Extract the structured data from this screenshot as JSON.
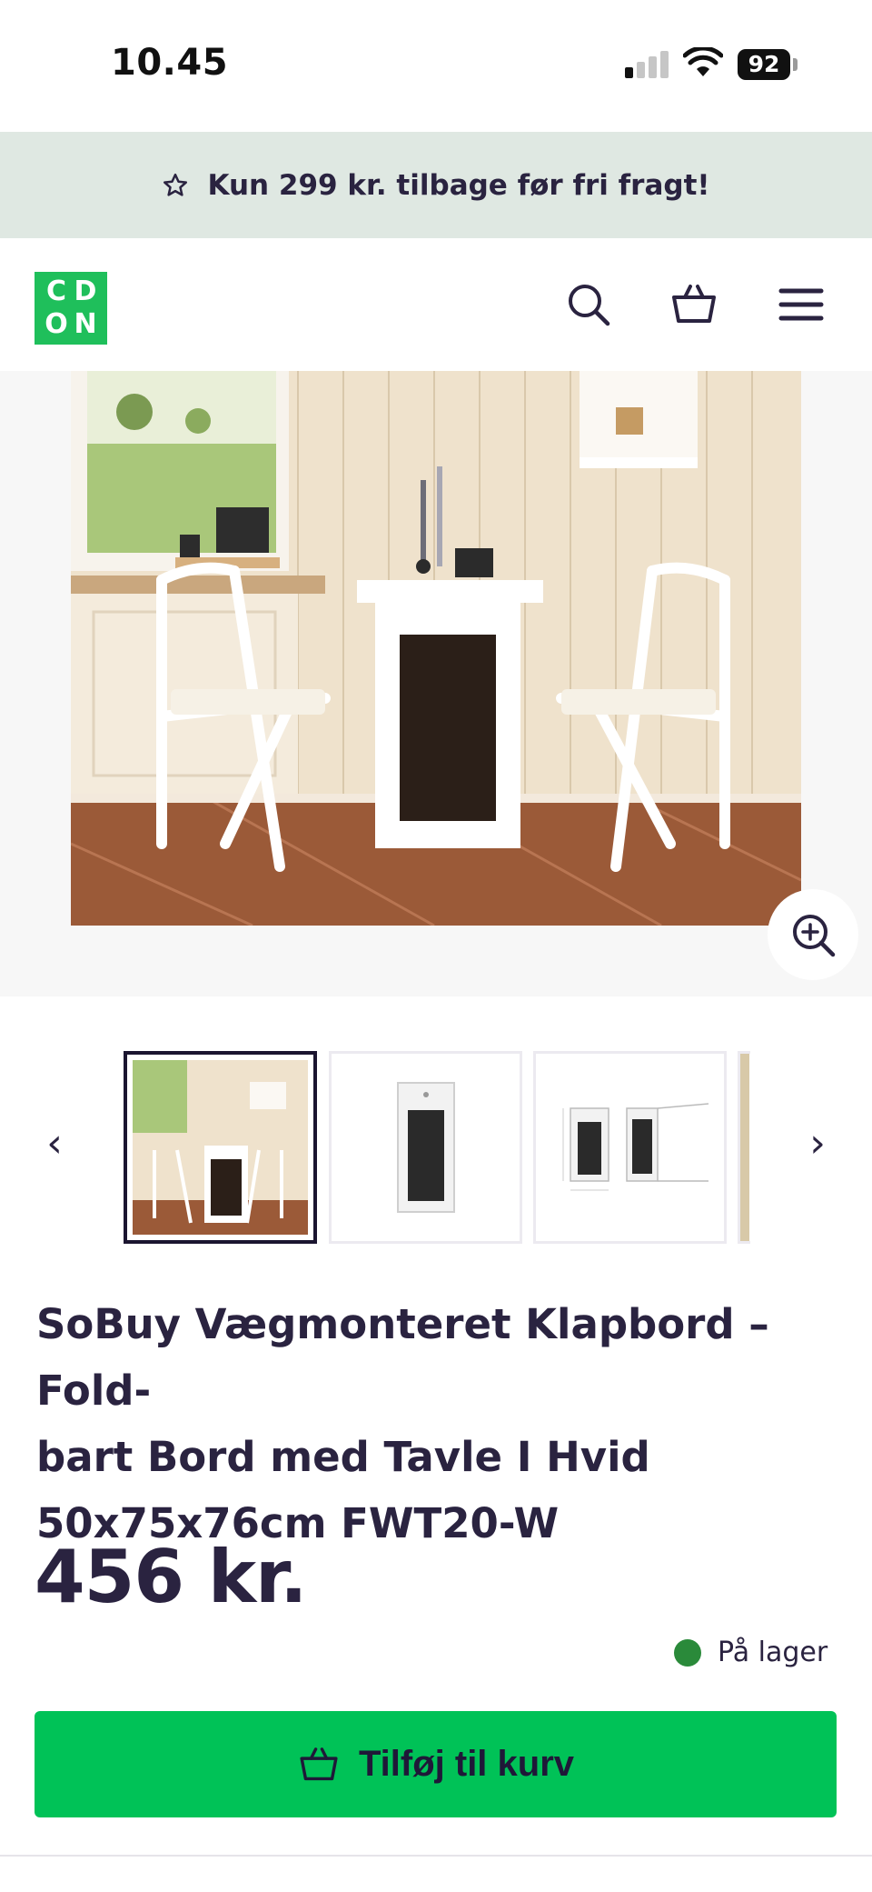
{
  "status_bar": {
    "time": "10.45",
    "battery": "92"
  },
  "promo": {
    "icon": "star-outline-icon",
    "text": "Kun 299 kr. tilbage før fri fragt!"
  },
  "header": {
    "logo_letters": [
      "C",
      "D",
      "O",
      "N"
    ],
    "brand_color": "#1fbf5b",
    "icons": [
      "search-icon",
      "basket-icon",
      "menu-icon"
    ]
  },
  "gallery": {
    "zoom_icon": "zoom-in-icon",
    "prev_arrow": "‹",
    "next_arrow": "›"
  },
  "product": {
    "title_line1": "SoBuy Vægmonteret Klapbord – Fold-",
    "title_line2": "bart Bord med Tavle I Hvid",
    "title_line3": "50x75x76cm FWT20-W",
    "price": "456 kr.",
    "stock_text": "På lager",
    "stock_color": "#2a8a3a",
    "add_to_cart_label": "Tilføj til kurv",
    "cta_color": "#00c257"
  }
}
